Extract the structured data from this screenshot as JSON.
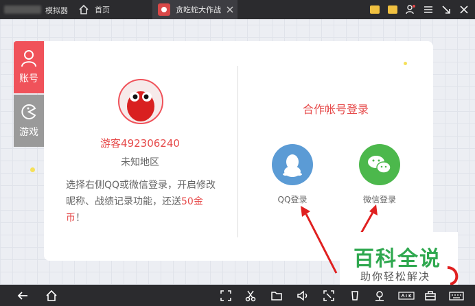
{
  "topbar": {
    "app_name": "模拟器",
    "home_tab": "首页",
    "game_tab": "贪吃蛇大作战"
  },
  "sidebar": {
    "account_label": "账号",
    "game_label": "游戏"
  },
  "profile": {
    "username": "游客492306240",
    "region": "未知地区",
    "desc_part1": "选择右侧QQ或微信登录，开启修改昵称、战绩记录功能，还送",
    "coins": "50金币",
    "desc_part2": "！"
  },
  "partner": {
    "title": "合作帐号登录",
    "qq_label": "QQ登录",
    "wechat_label": "微信登录"
  },
  "watermark": {
    "title": "百科全说",
    "subtitle": "助你轻松解决"
  },
  "colors": {
    "accent_red": "#f0525a",
    "qq_blue": "#5b9bd5",
    "wechat_green": "#4cb84c",
    "bar_dark": "#2b2b2e"
  },
  "icons": [
    "home-icon",
    "close-icon",
    "gift-icon",
    "user-check-icon",
    "menu-icon",
    "minimize-icon",
    "window-close-icon",
    "back-icon",
    "screenshot-icon",
    "scissors-icon",
    "folder-icon",
    "volume-icon",
    "fullscreen-icon",
    "shake-icon",
    "location-icon",
    "apk-icon",
    "toolbox-icon",
    "keyboard-icon",
    "person-icon",
    "pacman-icon",
    "qq-penguin-icon",
    "wechat-icon"
  ]
}
